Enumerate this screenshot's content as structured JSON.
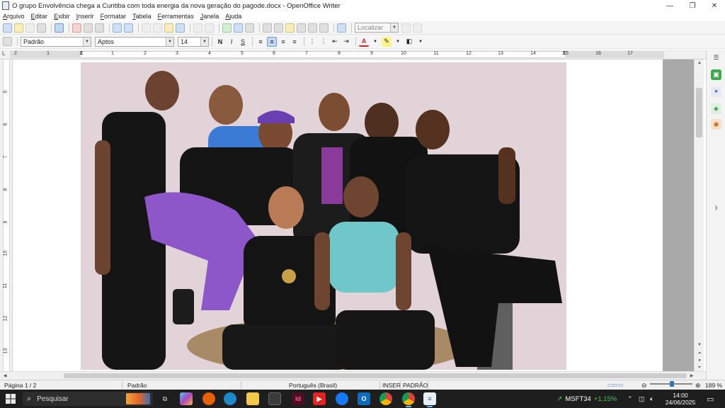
{
  "window": {
    "title": "O grupo Envolvência chega a Curitiba com toda energia da nova geração do pagode.docx - OpenOffice Writer",
    "controls": {
      "minimize": "—",
      "maximize": "❐",
      "close": "✕"
    }
  },
  "menu": {
    "items": [
      "Arquivo",
      "Editar",
      "Exibir",
      "Inserir",
      "Formatar",
      "Tabela",
      "Ferramentas",
      "Janela",
      "Ajuda"
    ]
  },
  "toolbar": {
    "find_placeholder": "Localizar"
  },
  "format": {
    "style": "Padrão",
    "font": "Aptos",
    "size": "14",
    "bold": "N",
    "italic": "I",
    "underline": "S"
  },
  "ruler": {
    "h_numbers": [
      "2",
      "1",
      "1",
      "2",
      "3",
      "4",
      "5",
      "6",
      "7",
      "8",
      "9",
      "10",
      "11",
      "12",
      "13",
      "14",
      "15",
      "16",
      "17"
    ],
    "v_numbers": [
      "5",
      "6",
      "7",
      "8",
      "9",
      "10",
      "11",
      "12",
      "13"
    ]
  },
  "status": {
    "page": "Página 1 / 2",
    "style": "Padrão",
    "language": "Português (Brasil)",
    "insert_mode": "INSER",
    "selection_mode": "PADRÃO",
    "zoom": "189 %"
  },
  "taskbar": {
    "search_placeholder": "Pesquisar",
    "stock": {
      "symbol": "MSFT34",
      "change": "+1,15%"
    },
    "time": "14:00",
    "date": "24/06/2025"
  },
  "colors": {
    "photo_background": "#e2d3d8",
    "taskbar": "#1e1e1e",
    "accent": "#3b6fb5"
  }
}
